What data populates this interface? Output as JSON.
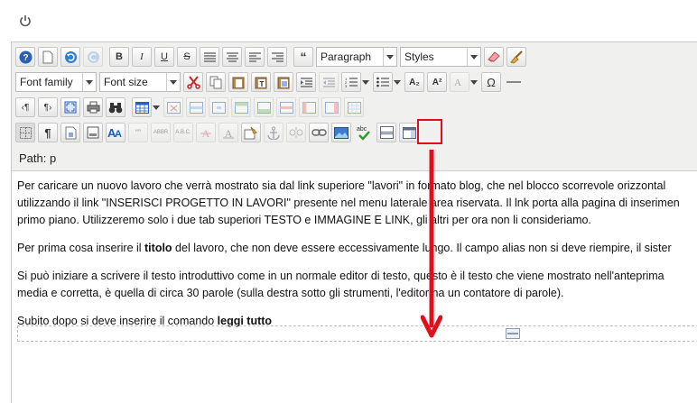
{
  "topbar": {
    "power_icon": "power-icon"
  },
  "toolbar": {
    "format_select": "Paragraph",
    "styles_select": "Styles",
    "font_family_select": "Font family",
    "font_size_select": "Font size",
    "quote_label": "“",
    "bold_label": "B",
    "italic_label": "I",
    "underline_label": "U",
    "strike_label": "S",
    "subscript_label": "A₂",
    "superscript_label": "A²",
    "omega_label": "Ω",
    "abbr_label": "ABBR",
    "acronym_label": "A.B.C.",
    "quote_char_label": "“”",
    "paragraph_mark": "¶",
    "ltr_label": "¶›",
    "rtl_label": "‹¶",
    "spell_abc": "abc"
  },
  "path": {
    "label": "Path: p"
  },
  "content": {
    "p1_line1": "Per caricare un nuovo lavoro che verrà mostrato sia dal link superiore \"lavori\" in formato blog, che nel blocco scorrevole orizzontal",
    "p1_line2": "utilizzando il link \"INSERISCI PROGETTO IN LAVORI\" presente nel menu laterale area riservata. Il lnk porta alla pagina di inserimen",
    "p1_line3": "primo piano. Utilizzeremo solo i due tab superiori TESTO e IMMAGINE E LINK, gli altri per ora non li consideriamo.",
    "p2_pre": "Per prima cosa inserire il ",
    "p2_bold": "titolo",
    "p2_post": " del lavoro, che non deve essere eccessivamente lungo. Il campo alias non si deve riempire, il sister",
    "p3_line1": "Si può iniziare a scrivere il testo introduttivo come in un normale editor di testo, questo è il testo che viene mostrato nell'anteprima",
    "p3_line2": "media e corretta, è quella di circa 30 parole (sulla destra sotto gli strumenti, l'editor ha un contatore di parole).",
    "p4_pre": "Subito dopo si deve inserire il comando ",
    "p4_bold": "leggi tutto"
  },
  "colors": {
    "toolbar_bg": "#f0f0ee",
    "highlight": "#e0101a",
    "annotation_arrow": "#e0101a"
  }
}
